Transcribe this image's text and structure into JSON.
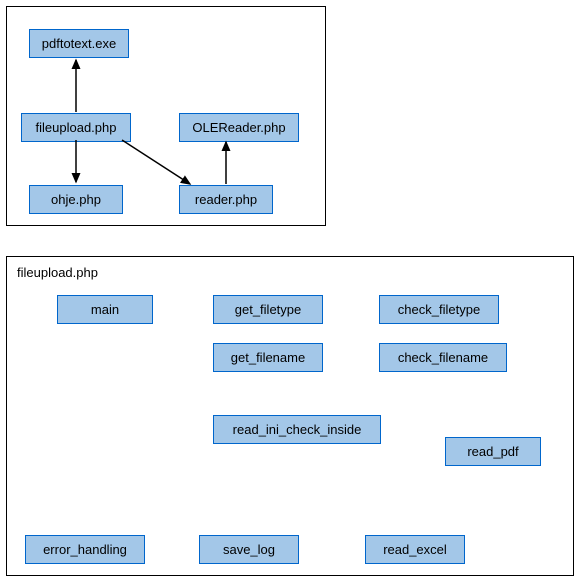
{
  "container1": {
    "nodes": {
      "pdftotext": "pdftotext.exe",
      "fileupload": "fileupload.php",
      "olereader": "OLEReader.php",
      "ohje": "ohje.php",
      "reader": "reader.php"
    }
  },
  "container2": {
    "title": "fileupload.php",
    "nodes": {
      "main": "main",
      "get_filetype": "get_filetype",
      "check_filetype": "check_filetype",
      "get_filename": "get_filename",
      "check_filename": "check_filename",
      "read_ini_check_inside": "read_ini_check_inside",
      "read_pdf": "read_pdf",
      "error_handling": "error_handling",
      "save_log": "save_log",
      "read_excel": "read_excel"
    }
  }
}
